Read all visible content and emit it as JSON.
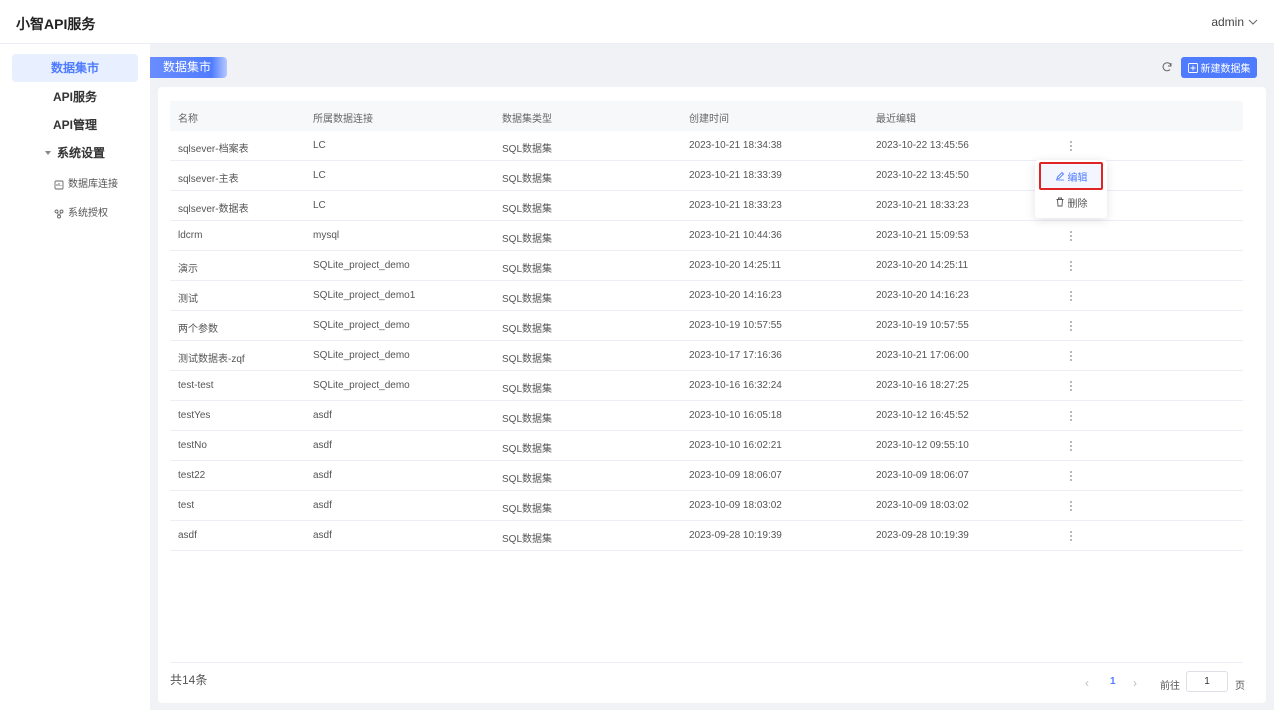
{
  "app": {
    "title": "小智API服务",
    "user": "admin"
  },
  "sidebar": {
    "items": [
      {
        "label": "数据集市"
      },
      {
        "label": "API服务"
      },
      {
        "label": "API管理"
      },
      {
        "label": "系统设置"
      }
    ],
    "sub_items": [
      {
        "label": "数据库连接",
        "icon": "database-icon"
      },
      {
        "label": "系统授权",
        "icon": "authorization-icon"
      }
    ]
  },
  "page": {
    "tag": "数据集市",
    "new_button": "新建数据集"
  },
  "table": {
    "columns": [
      "名称",
      "所属数据连接",
      "数据集类型",
      "创建时间",
      "最近编辑"
    ],
    "rows": [
      [
        "sqlsever-档案表",
        "LC",
        "SQL数据集",
        "2023-10-21 18:34:38",
        "2023-10-22 13:45:56"
      ],
      [
        "sqlsever-主表",
        "LC",
        "SQL数据集",
        "2023-10-21 18:33:39",
        "2023-10-22 13:45:50"
      ],
      [
        "sqlsever-数据表",
        "LC",
        "SQL数据集",
        "2023-10-21 18:33:23",
        "2023-10-21 18:33:23"
      ],
      [
        "ldcrm",
        "mysql",
        "SQL数据集",
        "2023-10-21 10:44:36",
        "2023-10-21 15:09:53"
      ],
      [
        "演示",
        "SQLite_project_demo",
        "SQL数据集",
        "2023-10-20 14:25:11",
        "2023-10-20 14:25:11"
      ],
      [
        "测试",
        "SQLite_project_demo1",
        "SQL数据集",
        "2023-10-20 14:16:23",
        "2023-10-20 14:16:23"
      ],
      [
        "两个参数",
        "SQLite_project_demo",
        "SQL数据集",
        "2023-10-19 10:57:55",
        "2023-10-19 10:57:55"
      ],
      [
        "测试数据表-zqf",
        "SQLite_project_demo",
        "SQL数据集",
        "2023-10-17 17:16:36",
        "2023-10-21 17:06:00"
      ],
      [
        "test-test",
        "SQLite_project_demo",
        "SQL数据集",
        "2023-10-16 16:32:24",
        "2023-10-16 18:27:25"
      ],
      [
        "testYes",
        "asdf",
        "SQL数据集",
        "2023-10-10 16:05:18",
        "2023-10-12 16:45:52"
      ],
      [
        "testNo",
        "asdf",
        "SQL数据集",
        "2023-10-10 16:02:21",
        "2023-10-12 09:55:10"
      ],
      [
        "test22",
        "asdf",
        "SQL数据集",
        "2023-10-09 18:06:07",
        "2023-10-09 18:06:07"
      ],
      [
        "test",
        "asdf",
        "SQL数据集",
        "2023-10-09 18:03:02",
        "2023-10-09 18:03:02"
      ],
      [
        "asdf",
        "asdf",
        "SQL数据集",
        "2023-09-28 10:19:39",
        "2023-09-28 10:19:39"
      ]
    ]
  },
  "dropdown": {
    "edit": "编辑",
    "delete": "删除"
  },
  "pagination": {
    "total": "共14条",
    "current": "1",
    "goto_label": "前往",
    "goto_value": "1",
    "unit": "页"
  },
  "colors": {
    "accent": "#4f7cff",
    "highlight_border": "#e02424"
  }
}
